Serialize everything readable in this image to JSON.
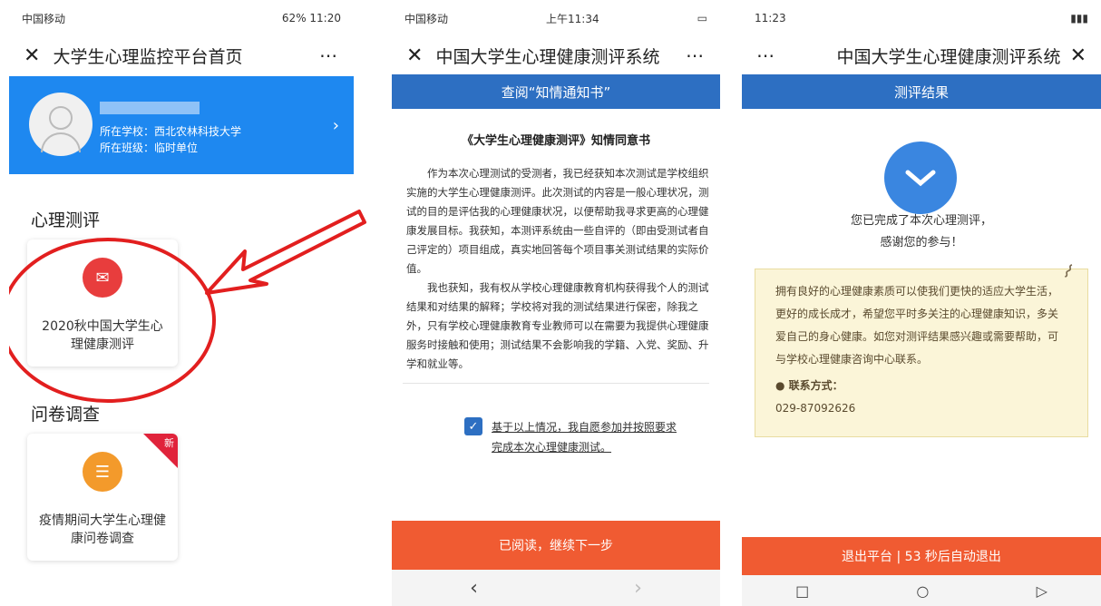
{
  "phone1": {
    "status_left": "中国移动",
    "status_right": "62% 11:20",
    "nav_title": "大学生心理监控平台首页",
    "school": "所在学校：西北农林科技大学",
    "class": "所在班级：临时单位",
    "section_test": "心理测评",
    "card_test_label": "2020秋中国大学生心理健康测评",
    "section_survey": "问卷调查",
    "card_survey_label": "疫情期间大学生心理健康问卷调查",
    "badge_new": "新"
  },
  "phone2": {
    "status_left": "中国移动",
    "status_time": "上午11:34",
    "nav_title": "中国大学生心理健康测评系统",
    "banner": "查阅“知情通知书”",
    "doc_title": "《大学生心理健康测评》知情同意书",
    "para1": "作为本次心理测试的受测者，我已经获知本次测试是学校组织实施的大学生心理健康测评。此次测试的内容是一般心理状况，测试的目的是评估我的心理健康状况，以便帮助我寻求更高的心理健康发展目标。我获知，本测评系统由一些自评的（即由受测试者自己评定的）项目组成，真实地回答每个项目事关测试结果的实际价值。",
    "para2": "我也获知，我有权从学校心理健康教育机构获得我个人的测试结果和对结果的解释；学校将对我的测试结果进行保密，除我之外，只有学校心理健康教育专业教师可以在需要为我提供心理健康服务时接触和使用；测试结果不会影响我的学籍、入党、奖励、升学和就业等。",
    "agree_text": "基于以上情况，我自愿参加并按照要求完成本次心理健康测试。",
    "continue_button": "已阅读，继续下一步"
  },
  "phone3": {
    "status_right": "11:23",
    "nav_title": "中国大学生心理健康测评系统",
    "banner": "测评结果",
    "msg_line1": "您已完成了本次心理测评，",
    "msg_line2": "感谢您的参与！",
    "note_text": "拥有良好的心理健康素质可以使我们更快的适应大学生活，更好的成长成才，希望您平时多关注的心理健康知识，多关爱自己的身心健康。如您对测评结果感兴趣或需要帮助，可与学校心理健康咨询中心联系。",
    "contact_label": "联系方式：",
    "contact_phone": "029-87092626",
    "exit_button": "退出平台 | 53 秒后自动退出"
  }
}
